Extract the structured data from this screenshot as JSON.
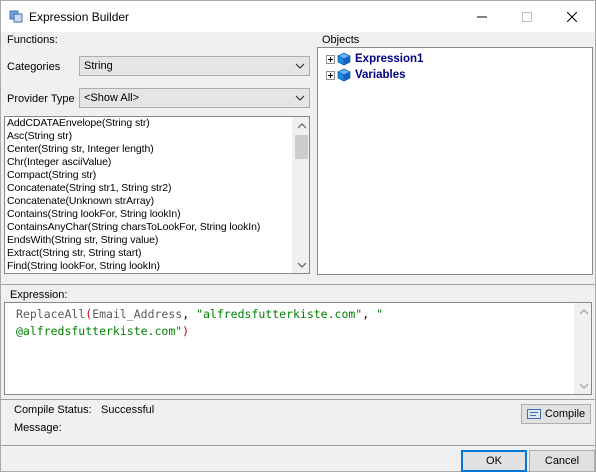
{
  "window": {
    "title": "Expression Builder",
    "min_icon": "minimize-icon",
    "max_icon": "maximize-icon",
    "close_icon": "close-icon"
  },
  "functions": {
    "group_label": "Functions:",
    "categories_label": "Categories",
    "categories_value": "String",
    "provider_label": "Provider Type",
    "provider_value": "<Show All>",
    "list": [
      "AddCDATAEnvelope(String str)",
      "Asc(String str)",
      "Center(String str, Integer length)",
      "Chr(Integer asciiValue)",
      "Compact(String str)",
      "Concatenate(String str1, String str2)",
      "Concatenate(Unknown strArray)",
      "Contains(String lookFor, String lookIn)",
      "ContainsAnyChar(String charsToLookFor, String lookIn)",
      "EndsWith(String str, String value)",
      "Extract(String str, String start)",
      "Find(String lookFor, String lookIn)"
    ]
  },
  "objects": {
    "group_label": "Objects",
    "nodes": [
      {
        "label": "Expression1",
        "icon": "cube-icon"
      },
      {
        "label": "Variables",
        "icon": "cube-icon"
      }
    ]
  },
  "expression": {
    "label": "Expression:",
    "line1": {
      "fn": "ReplaceAll",
      "open": "(",
      "arg1": "Email_Address",
      "sep1": ", ",
      "arg2": "\"alfredsfutterkiste.com\"",
      "sep2": ", ",
      "arg3_start": "\""
    },
    "line2": {
      "arg3_end": "@alfredsfutterkiste.com\"",
      "close": ")"
    }
  },
  "status": {
    "compile_status_label": "Compile Status:",
    "compile_status_value": "Successful",
    "message_label": "Message:",
    "message_value": "",
    "compile_button": "Compile"
  },
  "footer": {
    "ok": "OK",
    "cancel": "Cancel"
  },
  "colors": {
    "accent": "#0078d7",
    "string_literal": "#008000",
    "paren": "#cc0000",
    "tree_label": "#000080"
  }
}
